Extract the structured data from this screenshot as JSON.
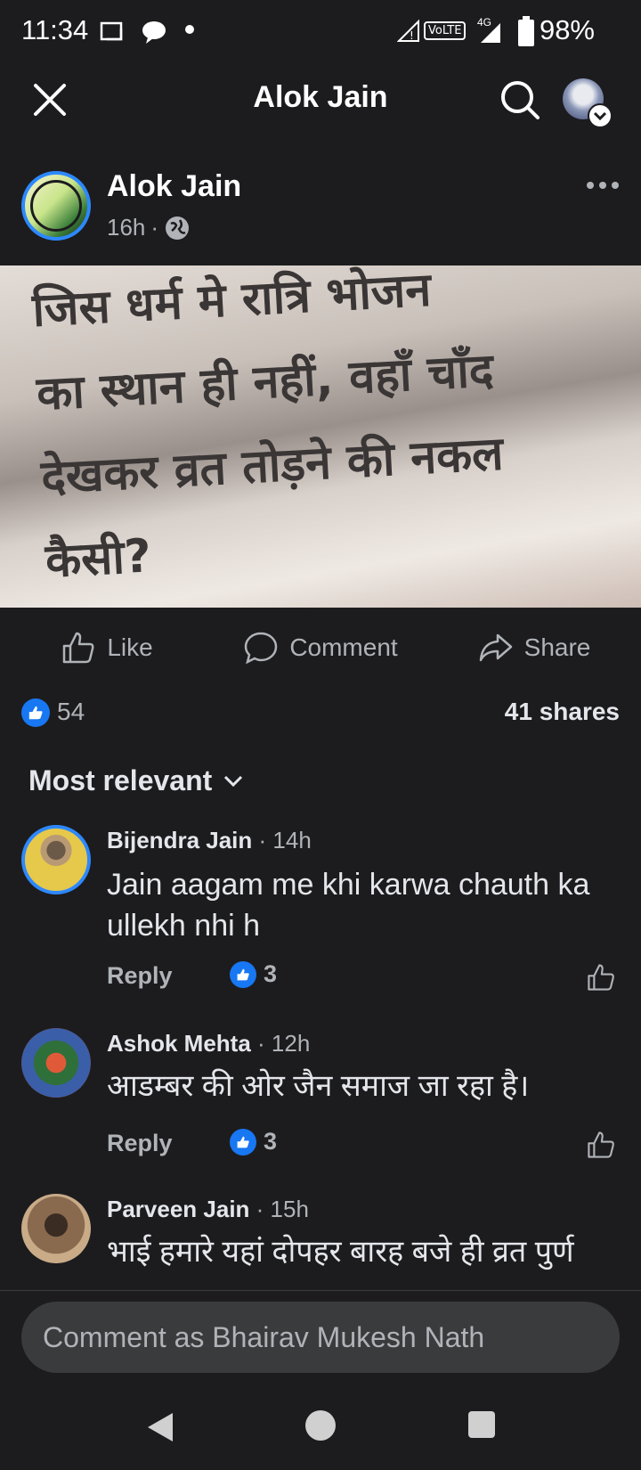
{
  "status_bar": {
    "time": "11:34",
    "battery": "98%",
    "network": "4G",
    "volte": "VoLTE"
  },
  "app_bar": {
    "title": "Alok Jain"
  },
  "post": {
    "author": "Alok Jain",
    "time": "16h",
    "separator": "·",
    "audience_icon": "globe-icon",
    "image_text": [
      "जिस धर्म मे रात्रि भोजन",
      "का स्थान ही नहीं, वहाँ चाँद",
      "देखकर व्रत तोड़ने की नकल",
      "कैसी?"
    ]
  },
  "actions": {
    "like": "Like",
    "comment": "Comment",
    "share": "Share"
  },
  "stats": {
    "reactions": "54",
    "shares": "41 shares"
  },
  "sort_label": "Most relevant",
  "comments": [
    {
      "name": "Bijendra Jain",
      "time": "· 14h",
      "text": "Jain aagam me khi karwa chauth ka ullekh nhi h",
      "reply": "Reply",
      "likes": "3"
    },
    {
      "name": "Ashok Mehta",
      "time": "· 12h",
      "text": "आडम्बर की ओर  जैन समाज जा रहा है।",
      "reply": "Reply",
      "likes": "3"
    },
    {
      "name": "Parveen Jain",
      "time": "· 15h",
      "text": "भाई हमारे यहां दोपहर बारह बजे ही व्रत पुर्ण",
      "reply": "Reply",
      "likes": ""
    }
  ],
  "comment_input": {
    "placeholder": "Comment as Bhairav Mukesh Nath"
  },
  "colors": {
    "background": "#1c1c1e",
    "accent": "#1877f2",
    "text": "#e4e6eb",
    "muted": "#b0b3b8"
  }
}
